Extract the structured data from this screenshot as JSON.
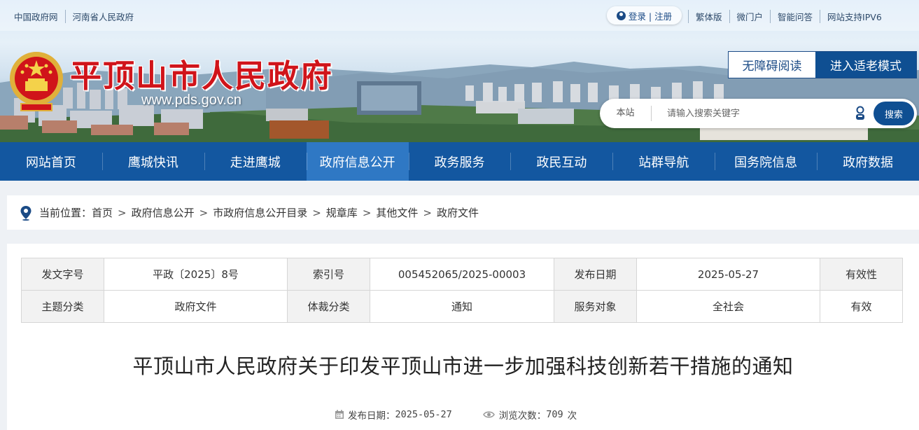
{
  "topbar": {
    "left_links": [
      "中国政府网",
      "河南省人民政府"
    ],
    "login_label": "登录 | 注册",
    "right_links": [
      "繁体版",
      "微门户",
      "智能问答",
      "网站支持IPV6"
    ]
  },
  "site": {
    "title": "平顶山市人民政府",
    "domain": "www.pds.gov.cn"
  },
  "modes": {
    "accessible": "无障碍阅读",
    "elder": "进入适老模式"
  },
  "search": {
    "scope": "本站",
    "placeholder": "请输入搜索关键字",
    "button": "搜索"
  },
  "nav": {
    "items": [
      "网站首页",
      "鹰城快讯",
      "走进鹰城",
      "政府信息公开",
      "政务服务",
      "政民互动",
      "站群导航",
      "国务院信息",
      "政府数据"
    ],
    "active_index": 3
  },
  "breadcrumb": {
    "label": "当前位置：",
    "items": [
      "首页",
      "政府信息公开",
      "市政府信息公开目录",
      "规章库",
      "其他文件",
      "政府文件"
    ],
    "separator": ">"
  },
  "meta_table": {
    "row1": {
      "doc_no_label": "发文字号",
      "doc_no": "平政〔2025〕8号",
      "index_label": "索引号",
      "index": "005452065/2025-00003",
      "date_label": "发布日期",
      "date": "2025-05-27",
      "validity_label": "有效性"
    },
    "row2": {
      "topic_label": "主题分类",
      "topic": "政府文件",
      "genre_label": "体裁分类",
      "genre": "通知",
      "audience_label": "服务对象",
      "audience": "全社会",
      "validity": "有效"
    }
  },
  "article": {
    "title": "平顶山市人民政府关于印发平顶山市进一步加强科技创新若干措施的通知",
    "publish_label": "发布日期：",
    "publish_date": "2025-05-27",
    "views_label": "浏览次数：",
    "views": "709",
    "views_unit": "次"
  },
  "colors": {
    "nav_bg": "#1357a0",
    "nav_active": "#2f78c4",
    "title_red": "#d0141a",
    "brand_blue": "#0f4f92"
  }
}
